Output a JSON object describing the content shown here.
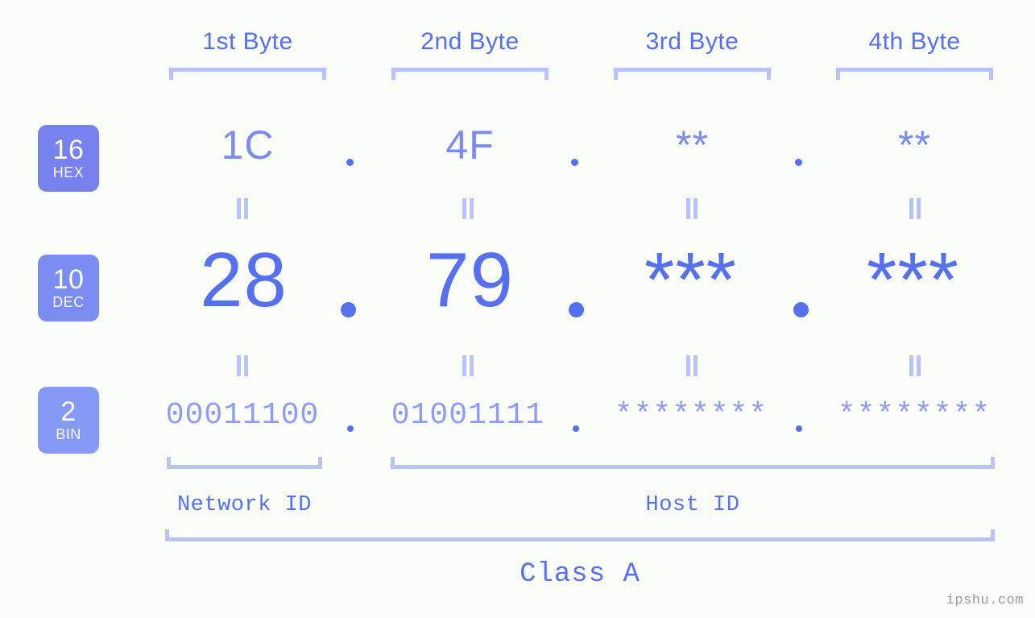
{
  "meta": {
    "background": "#fbfdf9",
    "accent": "#5570f1",
    "accent_light": "#b9c2fb",
    "watermark": "ipshu.com"
  },
  "byte_headers": [
    {
      "label": "1st Byte"
    },
    {
      "label": "2nd Byte"
    },
    {
      "label": "3rd Byte"
    },
    {
      "label": "4th Byte"
    }
  ],
  "radix_badges": [
    {
      "number": "16",
      "name": "HEX",
      "color": "#7782ef"
    },
    {
      "number": "10",
      "name": "DEC",
      "color": "#7b8df3"
    },
    {
      "number": "2",
      "name": "BIN",
      "color": "#859af6"
    }
  ],
  "rows": {
    "hex": {
      "radix": "16",
      "values": [
        "1C",
        "4F",
        "**",
        "**"
      ],
      "separator": "."
    },
    "dec": {
      "radix": "10",
      "values": [
        "28",
        "79",
        "***",
        "***"
      ],
      "separator": "."
    },
    "bin": {
      "radix": "2",
      "values": [
        "00011100",
        "01001111",
        "********",
        "********"
      ],
      "separator": "."
    }
  },
  "equality_marks": {
    "symbol": "||",
    "count_per_row": 4
  },
  "segments": {
    "network_id": "Network ID",
    "host_id": "Host ID",
    "class": "Class A"
  }
}
